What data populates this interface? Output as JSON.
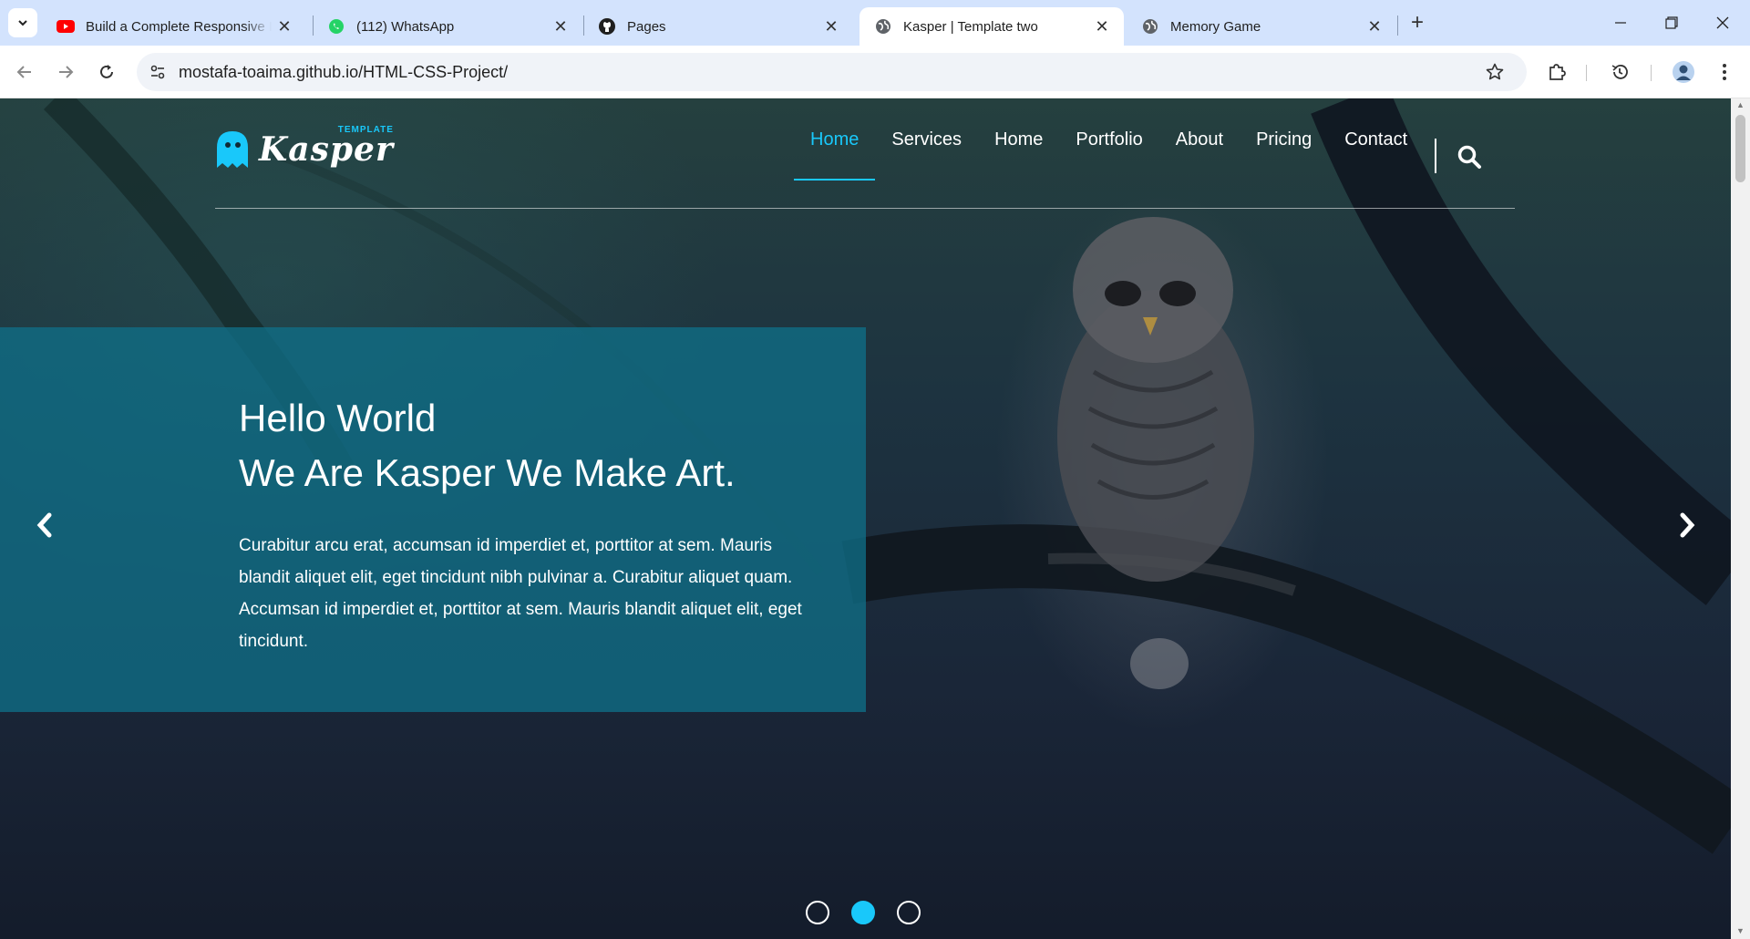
{
  "browser": {
    "tabs": [
      {
        "title": "Build a Complete Responsive Po",
        "favicon": "youtube-icon",
        "active": false
      },
      {
        "title": "(112) WhatsApp",
        "favicon": "whatsapp-icon",
        "active": false
      },
      {
        "title": "Pages",
        "favicon": "github-icon",
        "active": false
      },
      {
        "title": "Kasper | Template two",
        "favicon": "globe-icon",
        "active": true
      },
      {
        "title": "Memory Game",
        "favicon": "globe-icon",
        "active": false
      }
    ],
    "url": "mostafa-toaima.github.io/HTML-CSS-Project/"
  },
  "site": {
    "logo_text": "Kasper",
    "logo_small": "TEMPLATE",
    "nav": [
      "Home",
      "Services",
      "Home",
      "Portfolio",
      "About",
      "Pricing",
      "Contact"
    ],
    "active_nav_index": 0
  },
  "hero": {
    "title_line1": "Hello World",
    "title_line2": "We Are Kasper We Make Art.",
    "body": "Curabitur arcu erat, accumsan id imperdiet et, porttitor at sem. Mauris blandit aliquet elit, eget tincidunt nibh pulvinar a. Curabitur aliquet quam. Accumsan id imperdiet et, porttitor at sem. Mauris blandit aliquet elit, eget tincidunt.",
    "slides_count": 3,
    "active_slide": 2
  },
  "colors": {
    "accent": "#19c8fa",
    "hero_box": "#0f6e87",
    "tabstrip": "#d3e3fd"
  }
}
